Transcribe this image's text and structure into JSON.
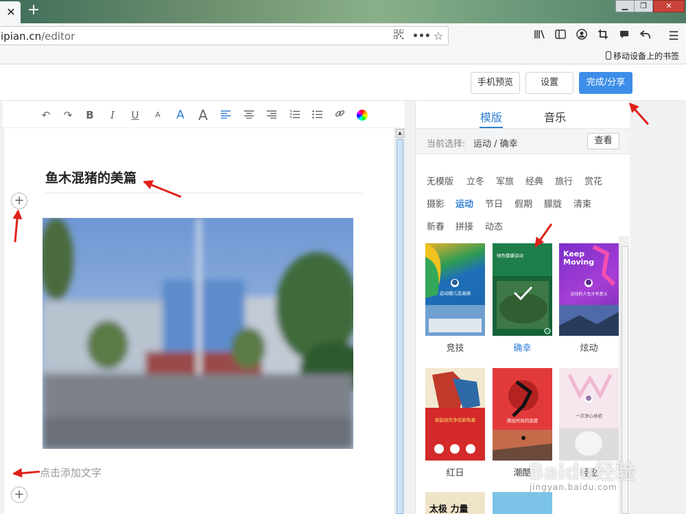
{
  "browser": {
    "tab_close": "✕",
    "new_tab": "+",
    "url_host": "ipian.cn",
    "url_path": "/editor",
    "mobile_bookmarks": "移动设备上的书签",
    "window_minimize": "▁",
    "window_maximize": "❐",
    "window_close": "✕"
  },
  "header": {
    "preview_button": "手机预览",
    "settings_button": "设置",
    "finish_button": "完成/分享"
  },
  "editor": {
    "title": "鱼木混猪的美篇",
    "add_text_placeholder": "点击添加文字",
    "toolbar": {
      "undo": "↶",
      "redo": "↷",
      "bold": "B",
      "italic": "I",
      "underline": "U",
      "font_small": "A",
      "font_medium": "A",
      "font_large": "A",
      "align_left": "≡",
      "align_center": "≡",
      "align_right": "≡",
      "ordered_list": "☰",
      "unordered_list": "☰",
      "link": "⚭"
    }
  },
  "panel": {
    "tabs": [
      {
        "label": "模版"
      },
      {
        "label": "音乐"
      }
    ],
    "active_tab": "模版",
    "current_selection_label": "当前选择:",
    "current_selection_value": "运动 / 确幸",
    "view_button": "查看",
    "categories": [
      "无模版",
      "立冬",
      "军旅",
      "经典",
      "旅行",
      "赏花",
      "摄影",
      "运动",
      "节日",
      "假期",
      "朦胧",
      "清柬",
      "新春",
      "拼接",
      "动态"
    ],
    "active_category": "运动",
    "templates": [
      {
        "name": "竞技",
        "poster_title": "运动健儿志高扬"
      },
      {
        "name": "确幸",
        "poster_title": "绿色健康运动",
        "selected": true
      },
      {
        "name": "炫动",
        "poster_title": "Keep Moving",
        "poster_sub": "运动的人生才有意义"
      },
      {
        "name": "红日",
        "poster_title": "掀起创先争优新热潮"
      },
      {
        "name": "潮酷",
        "poster_title": "燃出时尚的态度"
      },
      {
        "name": "轻盈",
        "poster_title": "一次净心体验"
      }
    ],
    "next_row_hint": "太极 力量"
  },
  "watermark": {
    "text": "Baidu经验",
    "url": "jingyan.baidu.com"
  },
  "colors": {
    "accent": "#2f7fd6",
    "primary_button": "#3d8ee8",
    "arrow": "#e0201b"
  }
}
